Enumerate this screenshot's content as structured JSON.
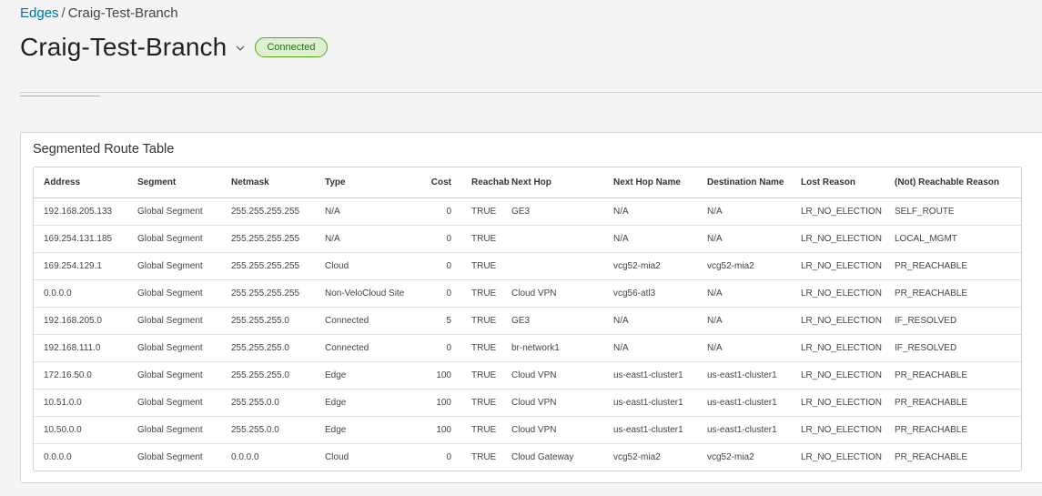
{
  "breadcrumb": {
    "root": "Edges",
    "separator": "/",
    "current": "Craig-Test-Branch"
  },
  "header": {
    "title": "Craig-Test-Branch",
    "status": "Connected",
    "chevron_icon": "chevron-down-icon"
  },
  "colors": {
    "accent": "#0072a3",
    "status_bg": "#dff0d0",
    "status_border": "#5aa220",
    "status_text": "#266c1b"
  },
  "table": {
    "title": "Segmented Route Table",
    "columns": {
      "address": "Address",
      "segment": "Segment",
      "netmask": "Netmask",
      "type": "Type",
      "cost": "Cost",
      "reachable": "Reachable",
      "next_hop": "Next Hop",
      "next_hop_name": "Next Hop Name",
      "destination_name": "Destination Name",
      "lost_reason": "Lost Reason",
      "not_reachable_reason": "(Not) Reachable Reason"
    },
    "rows": [
      {
        "address": "192.168.205.133",
        "segment": "Global Segment",
        "netmask": "255.255.255.255",
        "type": "N/A",
        "cost": "0",
        "reachable": "TRUE",
        "next_hop": "GE3",
        "next_hop_name": "N/A",
        "destination_name": "N/A",
        "lost_reason": "LR_NO_ELECTION",
        "reason": "SELF_ROUTE"
      },
      {
        "address": "169.254.131.185",
        "segment": "Global Segment",
        "netmask": "255.255.255.255",
        "type": "N/A",
        "cost": "0",
        "reachable": "TRUE",
        "next_hop": "",
        "next_hop_name": "N/A",
        "destination_name": "N/A",
        "lost_reason": "LR_NO_ELECTION",
        "reason": "LOCAL_MGMT"
      },
      {
        "address": "169.254.129.1",
        "segment": "Global Segment",
        "netmask": "255.255.255.255",
        "type": "Cloud",
        "cost": "0",
        "reachable": "TRUE",
        "next_hop": "",
        "next_hop_name": "vcg52-mia2",
        "destination_name": "vcg52-mia2",
        "lost_reason": "LR_NO_ELECTION",
        "reason": "PR_REACHABLE"
      },
      {
        "address": "0.0.0.0",
        "segment": "Global Segment",
        "netmask": "255.255.255.255",
        "type": "Non-VeloCloud Site",
        "cost": "0",
        "reachable": "TRUE",
        "next_hop": "Cloud VPN",
        "next_hop_name": "vcg56-atl3",
        "destination_name": "N/A",
        "lost_reason": "LR_NO_ELECTION",
        "reason": "PR_REACHABLE"
      },
      {
        "address": "192.168.205.0",
        "segment": "Global Segment",
        "netmask": "255.255.255.0",
        "type": "Connected",
        "cost": "5",
        "reachable": "TRUE",
        "next_hop": "GE3",
        "next_hop_name": "N/A",
        "destination_name": "N/A",
        "lost_reason": "LR_NO_ELECTION",
        "reason": "IF_RESOLVED"
      },
      {
        "address": "192.168.111.0",
        "segment": "Global Segment",
        "netmask": "255.255.255.0",
        "type": "Connected",
        "cost": "0",
        "reachable": "TRUE",
        "next_hop": "br-network1",
        "next_hop_name": "N/A",
        "destination_name": "N/A",
        "lost_reason": "LR_NO_ELECTION",
        "reason": "IF_RESOLVED"
      },
      {
        "address": "172.16.50.0",
        "segment": "Global Segment",
        "netmask": "255.255.255.0",
        "type": "Edge",
        "cost": "100",
        "reachable": "TRUE",
        "next_hop": "Cloud VPN",
        "next_hop_name": "us-east1-cluster1",
        "destination_name": "us-east1-cluster1",
        "lost_reason": "LR_NO_ELECTION",
        "reason": "PR_REACHABLE"
      },
      {
        "address": "10.51.0.0",
        "segment": "Global Segment",
        "netmask": "255.255.0.0",
        "type": "Edge",
        "cost": "100",
        "reachable": "TRUE",
        "next_hop": "Cloud VPN",
        "next_hop_name": "us-east1-cluster1",
        "destination_name": "us-east1-cluster1",
        "lost_reason": "LR_NO_ELECTION",
        "reason": "PR_REACHABLE"
      },
      {
        "address": "10.50.0.0",
        "segment": "Global Segment",
        "netmask": "255.255.0.0",
        "type": "Edge",
        "cost": "100",
        "reachable": "TRUE",
        "next_hop": "Cloud VPN",
        "next_hop_name": "us-east1-cluster1",
        "destination_name": "us-east1-cluster1",
        "lost_reason": "LR_NO_ELECTION",
        "reason": "PR_REACHABLE"
      },
      {
        "address": "0.0.0.0",
        "segment": "Global Segment",
        "netmask": "0.0.0.0",
        "type": "Cloud",
        "cost": "0",
        "reachable": "TRUE",
        "next_hop": "Cloud Gateway",
        "next_hop_name": "vcg52-mia2",
        "destination_name": "vcg52-mia2",
        "lost_reason": "LR_NO_ELECTION",
        "reason": "PR_REACHABLE"
      }
    ]
  }
}
